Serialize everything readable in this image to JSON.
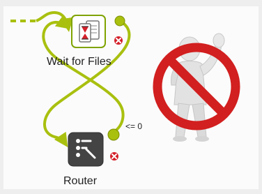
{
  "nodes": {
    "wait": {
      "label": "Wait for Files"
    },
    "router": {
      "label": "Router"
    }
  },
  "connection": {
    "condition_label": "<= 0"
  },
  "colors": {
    "connector": "#a9c00f",
    "connector_dark": "#7c8f00",
    "error_red": "#d4202a",
    "prohibition_red": "#d21f1f",
    "router_icon_bg": "#444444",
    "wait_icon_border": "#7fa300"
  },
  "icons": {
    "wait_node": "hourglass-document-icon",
    "router_node": "router-icon",
    "error_port": "error-x-icon",
    "prohibition": "prohibition-person-icon"
  }
}
